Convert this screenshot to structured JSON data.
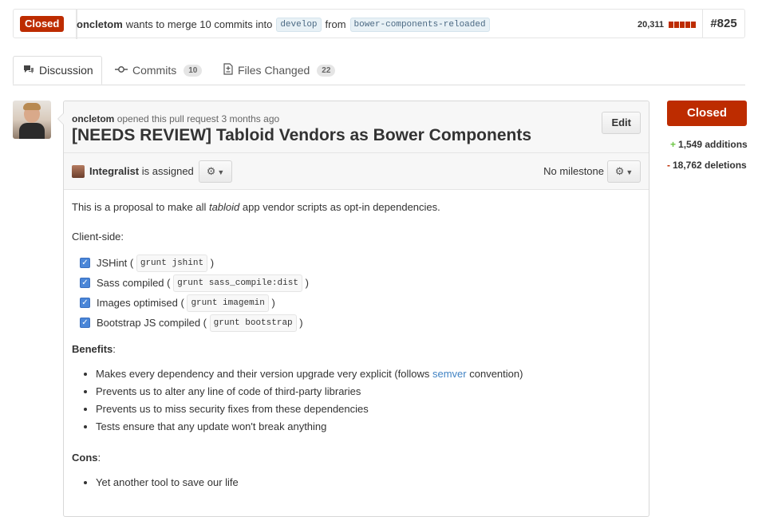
{
  "pull": {
    "state": "Closed",
    "author": "oncletom",
    "summary_text": "wants to merge 10 commits into",
    "base_branch": "develop",
    "from_text": "from",
    "head_branch": "bower-components-reloaded",
    "diff_total": "20,311",
    "number": "#825"
  },
  "tabs": [
    {
      "label": "Discussion",
      "icon": "comment-icon"
    },
    {
      "label": "Commits",
      "icon": "commit-icon",
      "count": "10"
    },
    {
      "label": "Files Changed",
      "icon": "file-diff-icon",
      "count": "22"
    }
  ],
  "discussion": {
    "author": "oncletom",
    "meta_text": "opened this pull request 3 months ago",
    "title": "[NEEDS REVIEW] Tabloid Vendors as Bower Components",
    "edit_label": "Edit",
    "assignee": "Integralist",
    "assigned_text": "is assigned",
    "milestone": "No milestone"
  },
  "body": {
    "intro_pre": "This is a proposal to make all ",
    "intro_em": "tabloid",
    "intro_post": " app vendor scripts as opt-in dependencies.",
    "client_side": "Client-side:",
    "tasks": [
      {
        "label": "JSHint (",
        "code": "grunt jshint",
        "end": ")"
      },
      {
        "label": "Sass compiled (",
        "code": "grunt sass_compile:dist",
        "end": ")"
      },
      {
        "label": "Images optimised (",
        "code": "grunt imagemin",
        "end": ")"
      },
      {
        "label": "Bootstrap JS compiled (",
        "code": "grunt bootstrap",
        "end": ")"
      }
    ],
    "benefits_title": "Benefits",
    "benefits": [
      {
        "pre": "Makes every dependency and their version upgrade very explicit (follows ",
        "link": "semver",
        "post": " convention)"
      },
      {
        "pre": "Prevents us to alter any line of code of third-party libraries"
      },
      {
        "pre": "Prevents us to miss security fixes from these dependencies"
      },
      {
        "pre": "Tests ensure that any update won't break anything"
      }
    ],
    "cons_title": "Cons",
    "cons": [
      "Yet another tool to save our life"
    ]
  },
  "sidebar": {
    "state_button": "Closed",
    "additions": "1,549 additions",
    "deletions": "18,762 deletions"
  },
  "colors": {
    "closed_red": "#bd2c00",
    "addition_green": "#6cc644",
    "link_blue": "#4183c4"
  }
}
